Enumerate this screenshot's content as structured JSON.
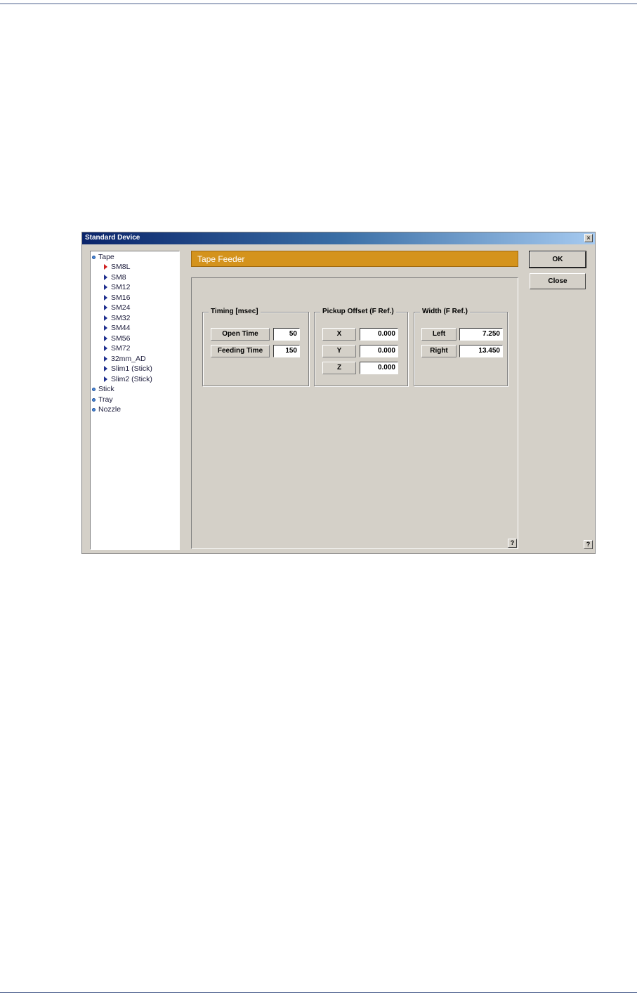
{
  "window": {
    "title": "Standard Device",
    "close_glyph": "×"
  },
  "tree": {
    "roots": [
      {
        "label": "Tape",
        "children": [
          "SM8L",
          "SM8",
          "SM12",
          "SM16",
          "SM24",
          "SM32",
          "SM44",
          "SM56",
          "SM72",
          "32mm_AD",
          "Slim1 (Stick)",
          "Slim2 (Stick)"
        ]
      },
      {
        "label": "Stick"
      },
      {
        "label": "Tray"
      },
      {
        "label": "Nozzle"
      }
    ],
    "selected": "SM8L"
  },
  "header": {
    "title": "Tape Feeder"
  },
  "timing": {
    "title": "Timing [msec]",
    "open_time_label": "Open Time",
    "open_time_value": "50",
    "feeding_time_label": "Feeding Time",
    "feeding_time_value": "150"
  },
  "pickup": {
    "title": "Pickup Offset (F Ref.)",
    "x_label": "X",
    "x_value": "0.000",
    "y_label": "Y",
    "y_value": "0.000",
    "z_label": "Z",
    "z_value": "0.000"
  },
  "width": {
    "title": "Width (F Ref.)",
    "left_label": "Left",
    "left_value": "7.250",
    "right_label": "Right",
    "right_value": "13.450"
  },
  "buttons": {
    "ok": "OK",
    "close": "Close",
    "help": "?"
  },
  "colors": {
    "header": "#d4931c",
    "dialog_bg": "#d4d0c8",
    "titlebar": "#0a246a"
  }
}
